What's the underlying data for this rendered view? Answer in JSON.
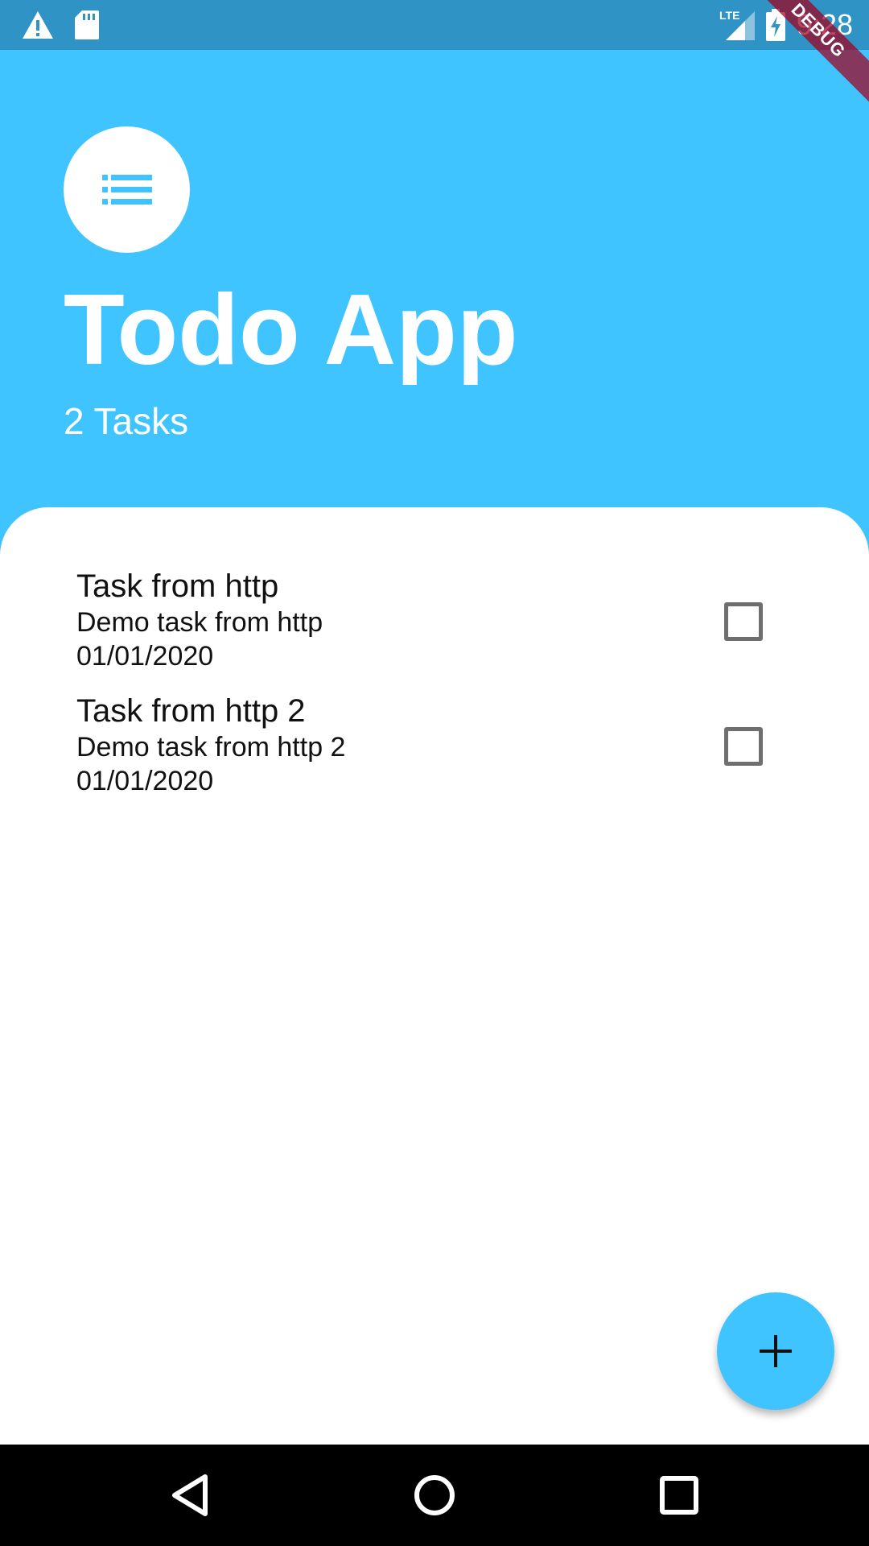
{
  "status_bar": {
    "time": "9:28",
    "network": "LTE",
    "left_icons": [
      "alert-icon",
      "sd-card-icon"
    ],
    "right_icons": [
      "lte-signal-icon",
      "battery-charging-icon"
    ]
  },
  "debug_banner": {
    "label": "DEBUG"
  },
  "header": {
    "icon": "list-icon",
    "title": "Todo App",
    "subtitle": "2 Tasks",
    "background_color": "#40c4ff"
  },
  "tasks": [
    {
      "title": "Task from http",
      "description": "Demo task from http",
      "date": "01/01/2020",
      "checked": false
    },
    {
      "title": "Task from http 2",
      "description": "Demo task from http 2",
      "date": "01/01/2020",
      "checked": false
    }
  ],
  "fab": {
    "icon": "add-icon",
    "color": "#40c4ff"
  },
  "nav_bar": {
    "buttons": [
      "back-icon",
      "home-icon",
      "recents-icon"
    ]
  }
}
